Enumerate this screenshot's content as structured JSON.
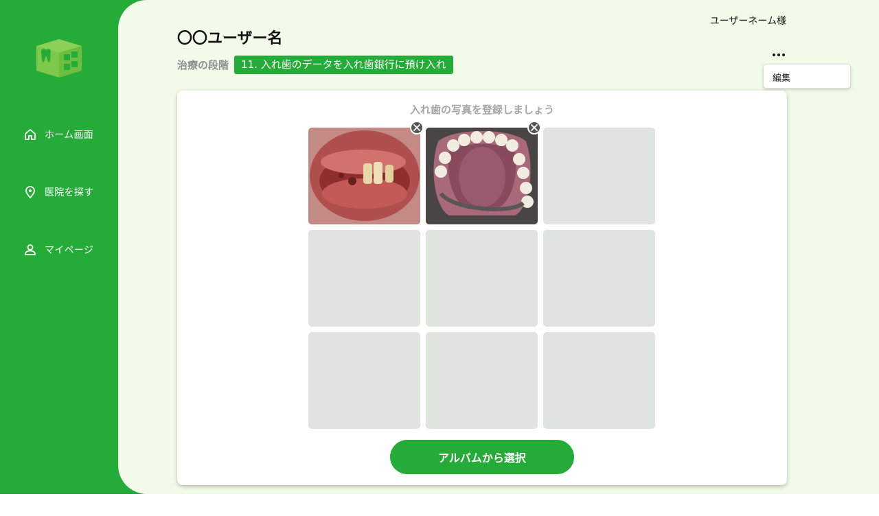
{
  "header": {
    "username": "ユーザーネーム様",
    "menu_items": [
      "編集"
    ]
  },
  "sidebar": {
    "items": [
      {
        "label": "ホーム画面",
        "icon": "home-icon"
      },
      {
        "label": "医院を探す",
        "icon": "location-pin-icon"
      },
      {
        "label": "マイページ",
        "icon": "user-icon"
      }
    ]
  },
  "main": {
    "title": "〇〇ユーザー名",
    "stage_label": "治療の段階",
    "stage_value": "11. 入れ歯のデータを入れ歯銀行に預け入れ",
    "card": {
      "heading": "入れ歯の写真を登録しましょう",
      "photos": [
        {
          "filled": true,
          "subject": "mouth-with-front-teeth"
        },
        {
          "filled": true,
          "subject": "upper-denture"
        },
        {
          "filled": false
        },
        {
          "filled": false
        },
        {
          "filled": false
        },
        {
          "filled": false
        },
        {
          "filled": false
        },
        {
          "filled": false
        },
        {
          "filled": false
        }
      ],
      "select_button": "アルバムから選択"
    }
  },
  "colors": {
    "brand_green": "#25ab38",
    "background_mint": "#f2faea",
    "placeholder_gray": "#e0e4df"
  }
}
